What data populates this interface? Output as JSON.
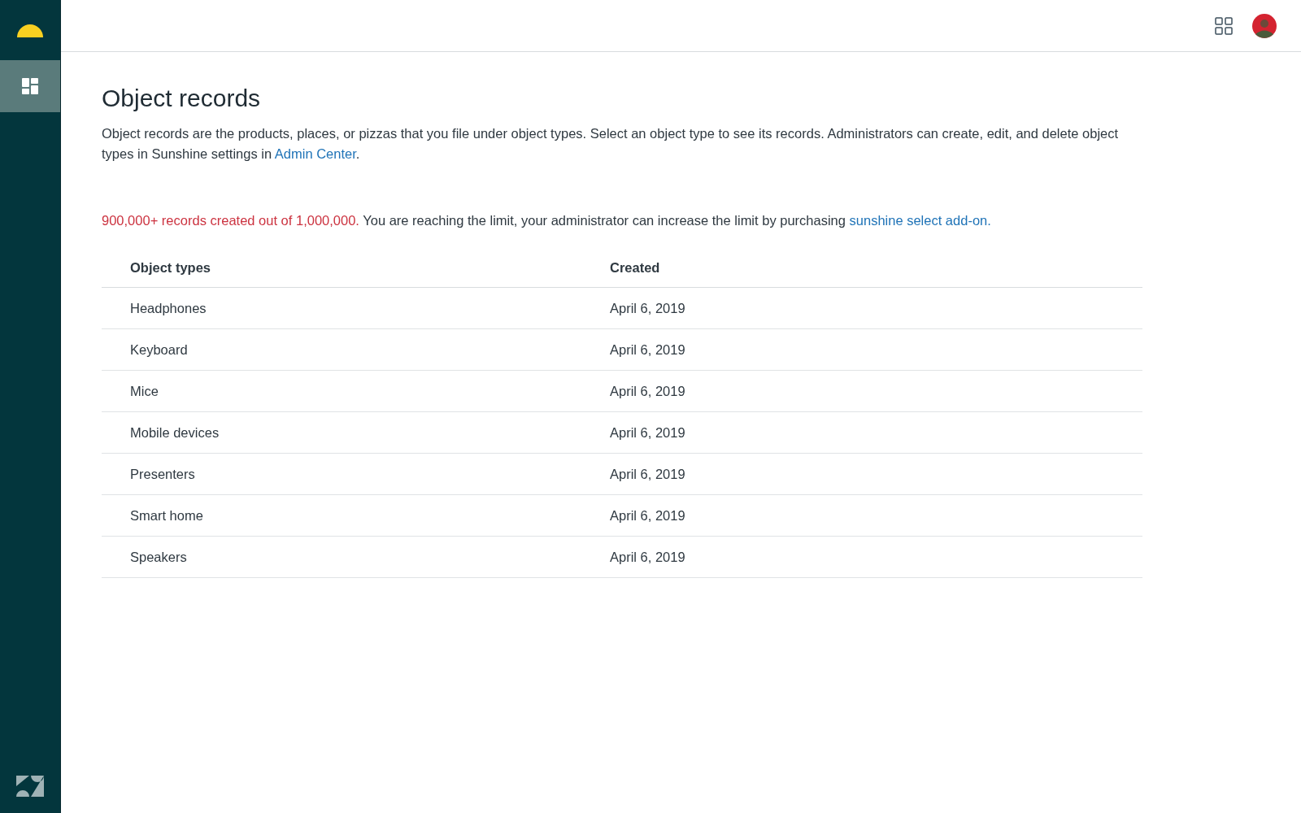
{
  "sidebar": {
    "nav_items": [
      {
        "selected": true
      }
    ]
  },
  "page": {
    "title": "Object records",
    "description": "Object records are the products, places, or pizzas that you file under object types. Select an object type to see its records. Administrators can create, edit, and delete object types in Sunshine settings in ",
    "description_link": "Admin Center",
    "description_end": ".",
    "limit_warning": "900,000+ records created out of 1,000,000.",
    "limit_message": "You are reaching the limit, your administrator can increase the limit by purchasing ",
    "limit_link": "sunshine select add-on."
  },
  "table": {
    "columns": [
      "Object types",
      "Created"
    ],
    "rows": [
      {
        "object_type": "Headphones",
        "created": "April 6, 2019"
      },
      {
        "object_type": "Keyboard",
        "created": "April 6, 2019"
      },
      {
        "object_type": "Mice",
        "created": "April 6, 2019"
      },
      {
        "object_type": "Mobile devices",
        "created": "April 6, 2019"
      },
      {
        "object_type": "Presenters",
        "created": "April 6, 2019"
      },
      {
        "object_type": "Smart home",
        "created": "April 6, 2019"
      },
      {
        "object_type": "Speakers",
        "created": "April 6, 2019"
      }
    ]
  }
}
